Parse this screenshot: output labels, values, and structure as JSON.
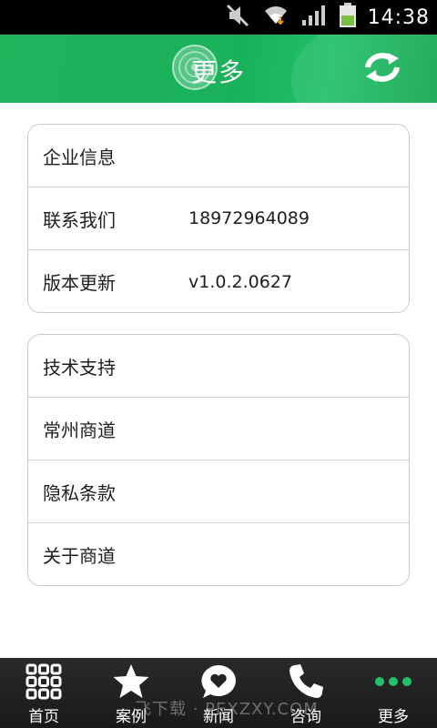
{
  "status_bar": {
    "time": "14:38",
    "icons": [
      "mute-icon",
      "wifi-icon",
      "signal-icon",
      "battery-icon"
    ]
  },
  "header": {
    "title": "更多",
    "logo_icon": "ripple-logo-icon",
    "refresh_icon": "refresh-icon",
    "accent_color": "#1fb35c"
  },
  "groups": [
    {
      "items": [
        {
          "label": "企业信息",
          "value": ""
        },
        {
          "label": "联系我们",
          "value": "18972964089"
        },
        {
          "label": "版本更新",
          "value": "v1.0.2.0627"
        }
      ]
    },
    {
      "items": [
        {
          "label": "技术支持",
          "value": ""
        },
        {
          "label": "常州商道",
          "value": ""
        },
        {
          "label": "隐私条款",
          "value": ""
        },
        {
          "label": "关于商道",
          "value": ""
        }
      ]
    }
  ],
  "bottom_nav": {
    "items": [
      {
        "label": "首页",
        "icon": "grid-icon"
      },
      {
        "label": "案例",
        "icon": "star-icon"
      },
      {
        "label": "新闻",
        "icon": "heart-bubble-icon"
      },
      {
        "label": "咨询",
        "icon": "phone-icon"
      },
      {
        "label": "更多",
        "icon": "more-dots-icon"
      }
    ],
    "active_color": "#21c06a"
  },
  "watermark": "飞下载 · PEXZXY.COM"
}
